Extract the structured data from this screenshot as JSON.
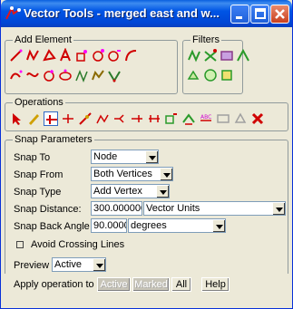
{
  "window": {
    "title": "Vector Tools - merged east and w..."
  },
  "add_element": {
    "legend": "Add Element",
    "icons_row1": [
      "line-icon",
      "polyline-icon",
      "polygon-icon",
      "text-icon",
      "point-icon",
      "cloud-icon",
      "symbol-icon",
      "arc-icon"
    ],
    "icons_row2": [
      "curve-icon",
      "spline-icon",
      "circle-icon",
      "ellipse-icon",
      "trace-icon",
      "region-icon",
      "node-icon"
    ]
  },
  "filters": {
    "legend": "Filters",
    "icons_row1": [
      "filter-a-icon",
      "filter-b-icon",
      "filter-c-icon",
      "filter-d-icon"
    ],
    "icons_row2": [
      "filter-e-icon",
      "filter-f-icon",
      "filter-g-icon"
    ]
  },
  "operations": {
    "legend": "Operations",
    "icons": [
      "select-arrow-icon",
      "pen-icon",
      "split-icon",
      "join-icon",
      "edit-vertex-icon",
      "smooth-icon",
      "merge-icon",
      "extend-icon",
      "node-link-icon",
      "move-icon",
      "label-icon",
      "attribute-icon",
      "delete-disabled-icon",
      "recycle-icon",
      "delete-icon"
    ]
  },
  "snap": {
    "legend": "Snap Parameters",
    "snap_to_label": "Snap To",
    "snap_to_value": "Node",
    "snap_from_label": "Snap From",
    "snap_from_value": "Both Vertices",
    "snap_type_label": "Snap Type",
    "snap_type_value": "Add Vertex",
    "snap_distance_label": "Snap Distance:",
    "snap_distance_value": "300.000000",
    "snap_distance_units": "Vector Units",
    "snap_back_angle_label": "Snap Back Angle",
    "snap_back_angle_value": "90.0000",
    "snap_back_angle_units": "degrees",
    "avoid_crossing_label": "Avoid Crossing Lines",
    "preview_label": "Preview",
    "preview_value": "Active"
  },
  "apply": {
    "label": "Apply operation to",
    "active": "Active",
    "marked": "Marked",
    "all": "All",
    "help": "Help"
  },
  "colors": {
    "title_bar": "#0055e5",
    "panel": "#ece9d8"
  }
}
